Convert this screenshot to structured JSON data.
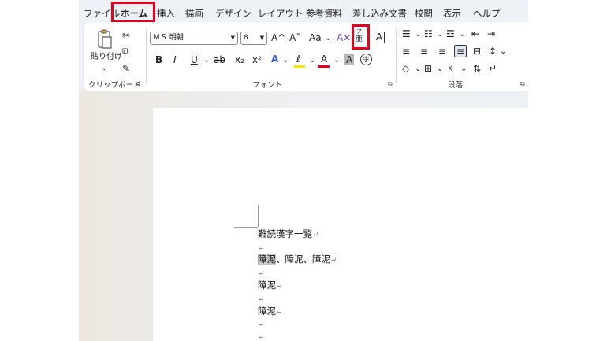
{
  "tabs": [
    "ファイル",
    "ホーム",
    "挿入",
    "描画",
    "デザイン",
    "レイアウト",
    "参考資料",
    "差し込み文書",
    "校閲",
    "表示",
    "ヘルプ"
  ],
  "clipboard": {
    "paste_label": "貼り付け",
    "group_label": "クリップボード"
  },
  "font": {
    "name": "ＭＳ 明朝",
    "size": "8",
    "group_label": "フォント",
    "grow": "A^",
    "shrink": "Aˇ",
    "case": "Aa",
    "bold": "B",
    "italic": "I",
    "underline": "U",
    "strike": "ab",
    "subscript": "x₂",
    "superscript": "x²",
    "effects": "A",
    "highlight": "ℓ",
    "font_color": "A",
    "char_shade": "A",
    "enclose": "字",
    "ruby_top": "ア",
    "ruby_bottom": "亜",
    "border": "A"
  },
  "paragraph": {
    "group_label": "段落"
  },
  "document": {
    "lines": [
      "難読漢字一覧",
      "",
      "障泥、障泥、障泥",
      "",
      "障泥",
      "",
      "障泥",
      "",
      ""
    ],
    "highlighted": "障泥",
    "rest_line3": "、障泥、障泥",
    "para_mark": "↵"
  },
  "colors": {
    "highlight_bar": "#f5e800",
    "font_color_bar": "#e8001c",
    "annotation": "#e8001c"
  }
}
